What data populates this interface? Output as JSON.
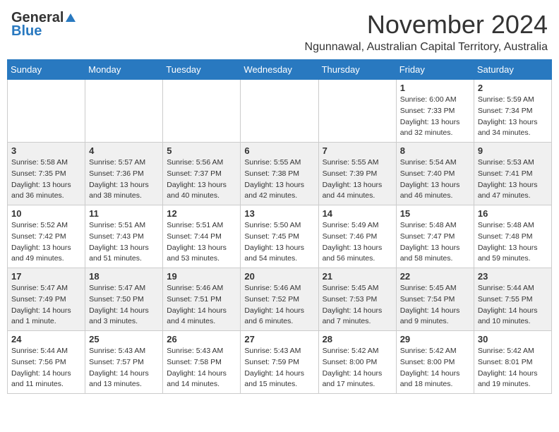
{
  "header": {
    "logo_general": "General",
    "logo_blue": "Blue",
    "month_title": "November 2024",
    "location": "Ngunnawal, Australian Capital Territory, Australia"
  },
  "weekdays": [
    "Sunday",
    "Monday",
    "Tuesday",
    "Wednesday",
    "Thursday",
    "Friday",
    "Saturday"
  ],
  "weeks": [
    [
      {
        "day": "",
        "info": ""
      },
      {
        "day": "",
        "info": ""
      },
      {
        "day": "",
        "info": ""
      },
      {
        "day": "",
        "info": ""
      },
      {
        "day": "",
        "info": ""
      },
      {
        "day": "1",
        "info": "Sunrise: 6:00 AM\nSunset: 7:33 PM\nDaylight: 13 hours\nand 32 minutes."
      },
      {
        "day": "2",
        "info": "Sunrise: 5:59 AM\nSunset: 7:34 PM\nDaylight: 13 hours\nand 34 minutes."
      }
    ],
    [
      {
        "day": "3",
        "info": "Sunrise: 5:58 AM\nSunset: 7:35 PM\nDaylight: 13 hours\nand 36 minutes."
      },
      {
        "day": "4",
        "info": "Sunrise: 5:57 AM\nSunset: 7:36 PM\nDaylight: 13 hours\nand 38 minutes."
      },
      {
        "day": "5",
        "info": "Sunrise: 5:56 AM\nSunset: 7:37 PM\nDaylight: 13 hours\nand 40 minutes."
      },
      {
        "day": "6",
        "info": "Sunrise: 5:55 AM\nSunset: 7:38 PM\nDaylight: 13 hours\nand 42 minutes."
      },
      {
        "day": "7",
        "info": "Sunrise: 5:55 AM\nSunset: 7:39 PM\nDaylight: 13 hours\nand 44 minutes."
      },
      {
        "day": "8",
        "info": "Sunrise: 5:54 AM\nSunset: 7:40 PM\nDaylight: 13 hours\nand 46 minutes."
      },
      {
        "day": "9",
        "info": "Sunrise: 5:53 AM\nSunset: 7:41 PM\nDaylight: 13 hours\nand 47 minutes."
      }
    ],
    [
      {
        "day": "10",
        "info": "Sunrise: 5:52 AM\nSunset: 7:42 PM\nDaylight: 13 hours\nand 49 minutes."
      },
      {
        "day": "11",
        "info": "Sunrise: 5:51 AM\nSunset: 7:43 PM\nDaylight: 13 hours\nand 51 minutes."
      },
      {
        "day": "12",
        "info": "Sunrise: 5:51 AM\nSunset: 7:44 PM\nDaylight: 13 hours\nand 53 minutes."
      },
      {
        "day": "13",
        "info": "Sunrise: 5:50 AM\nSunset: 7:45 PM\nDaylight: 13 hours\nand 54 minutes."
      },
      {
        "day": "14",
        "info": "Sunrise: 5:49 AM\nSunset: 7:46 PM\nDaylight: 13 hours\nand 56 minutes."
      },
      {
        "day": "15",
        "info": "Sunrise: 5:48 AM\nSunset: 7:47 PM\nDaylight: 13 hours\nand 58 minutes."
      },
      {
        "day": "16",
        "info": "Sunrise: 5:48 AM\nSunset: 7:48 PM\nDaylight: 13 hours\nand 59 minutes."
      }
    ],
    [
      {
        "day": "17",
        "info": "Sunrise: 5:47 AM\nSunset: 7:49 PM\nDaylight: 14 hours\nand 1 minute."
      },
      {
        "day": "18",
        "info": "Sunrise: 5:47 AM\nSunset: 7:50 PM\nDaylight: 14 hours\nand 3 minutes."
      },
      {
        "day": "19",
        "info": "Sunrise: 5:46 AM\nSunset: 7:51 PM\nDaylight: 14 hours\nand 4 minutes."
      },
      {
        "day": "20",
        "info": "Sunrise: 5:46 AM\nSunset: 7:52 PM\nDaylight: 14 hours\nand 6 minutes."
      },
      {
        "day": "21",
        "info": "Sunrise: 5:45 AM\nSunset: 7:53 PM\nDaylight: 14 hours\nand 7 minutes."
      },
      {
        "day": "22",
        "info": "Sunrise: 5:45 AM\nSunset: 7:54 PM\nDaylight: 14 hours\nand 9 minutes."
      },
      {
        "day": "23",
        "info": "Sunrise: 5:44 AM\nSunset: 7:55 PM\nDaylight: 14 hours\nand 10 minutes."
      }
    ],
    [
      {
        "day": "24",
        "info": "Sunrise: 5:44 AM\nSunset: 7:56 PM\nDaylight: 14 hours\nand 11 minutes."
      },
      {
        "day": "25",
        "info": "Sunrise: 5:43 AM\nSunset: 7:57 PM\nDaylight: 14 hours\nand 13 minutes."
      },
      {
        "day": "26",
        "info": "Sunrise: 5:43 AM\nSunset: 7:58 PM\nDaylight: 14 hours\nand 14 minutes."
      },
      {
        "day": "27",
        "info": "Sunrise: 5:43 AM\nSunset: 7:59 PM\nDaylight: 14 hours\nand 15 minutes."
      },
      {
        "day": "28",
        "info": "Sunrise: 5:42 AM\nSunset: 8:00 PM\nDaylight: 14 hours\nand 17 minutes."
      },
      {
        "day": "29",
        "info": "Sunrise: 5:42 AM\nSunset: 8:00 PM\nDaylight: 14 hours\nand 18 minutes."
      },
      {
        "day": "30",
        "info": "Sunrise: 5:42 AM\nSunset: 8:01 PM\nDaylight: 14 hours\nand 19 minutes."
      }
    ]
  ]
}
